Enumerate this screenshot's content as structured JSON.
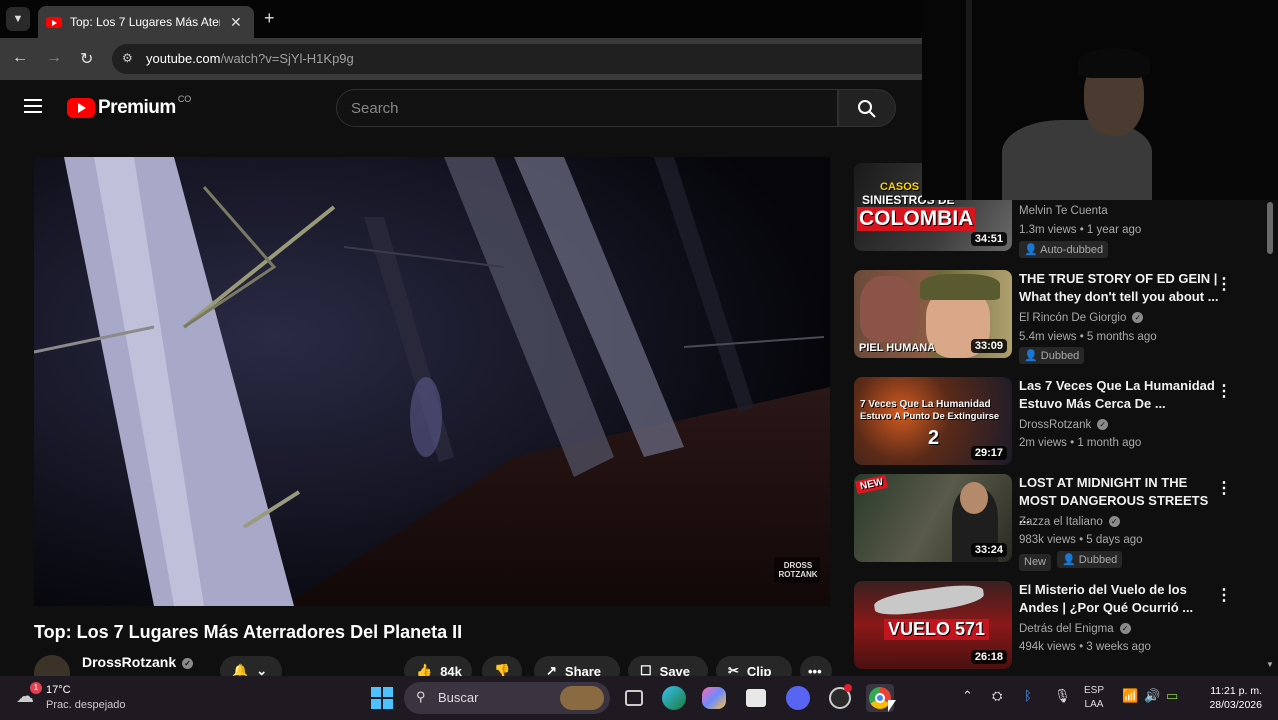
{
  "browser": {
    "tab_title": "Top: Los 7 Lugares Más Aterra",
    "url_domain": "youtube.com",
    "url_path": "/watch?v=SjYl-H1Kp9g"
  },
  "header": {
    "logo_text": "Premium",
    "country_code": "CO",
    "search_placeholder": "Search"
  },
  "video": {
    "title": "Top: Los 7 Lugares Más Aterradores Del Planeta II",
    "channel": "DrossRotzank",
    "likes": "84k",
    "share_label": "Share",
    "save_label": "Save",
    "clip_label": "Clip",
    "watermark": "DROSS ROTZANK"
  },
  "recommendations": [
    {
      "thumb_text": [
        "CASOS",
        "SINIESTROS DE",
        "COLOMBIA"
      ],
      "duration": "34:51",
      "title": "",
      "channel": "Melvin Te Cuenta",
      "stats": "1.3m views • 1 year ago",
      "badges": [
        "Auto-dubbed"
      ]
    },
    {
      "thumb_text": [
        "PIEL HUMANA"
      ],
      "duration": "33:09",
      "title": "THE TRUE STORY OF ED GEIN | What they don't tell you about ...",
      "channel": "El Rincón De Giorgio",
      "stats": "5.4m views • 5 months ago",
      "badges": [
        "Dubbed"
      ]
    },
    {
      "thumb_text": [
        "7 Veces Que La Humanidad",
        "Estuvo A Punto De Extinguirse",
        "2"
      ],
      "duration": "29:17",
      "title": "Las 7 Veces Que La Humanidad Estuvo Más Cerca De ...",
      "channel": "DrossRotzank",
      "stats": "2m views • 1 month ago",
      "badges": []
    },
    {
      "thumb_text": [
        "NEW"
      ],
      "duration": "33:24",
      "title": "LOST AT MIDNIGHT IN THE MOST DANGEROUS STREETS ...",
      "channel": "Zazza el Italiano",
      "stats": "983k views • 5 days ago",
      "badges": [
        "New",
        "Dubbed"
      ]
    },
    {
      "thumb_text": [
        "VUELO 571"
      ],
      "duration": "26:18",
      "title": "El Misterio del Vuelo de los Andes | ¿Por Qué Ocurrió ...",
      "channel": "Detrás del Enigma",
      "stats": "494k views • 3 weeks ago",
      "badges": []
    }
  ],
  "taskbar": {
    "weather_temp": "17°C",
    "weather_desc": "Prac. despejado",
    "weather_badge": "1",
    "search_label": "Buscar",
    "lang_1": "ESP",
    "lang_2": "LAA",
    "time": "11:21 p. m.",
    "date": "28/03/2026"
  },
  "colors": {
    "yt_red": "#ff0000",
    "bg": "#0f0f0f",
    "taskbar": "#1f1a22"
  }
}
